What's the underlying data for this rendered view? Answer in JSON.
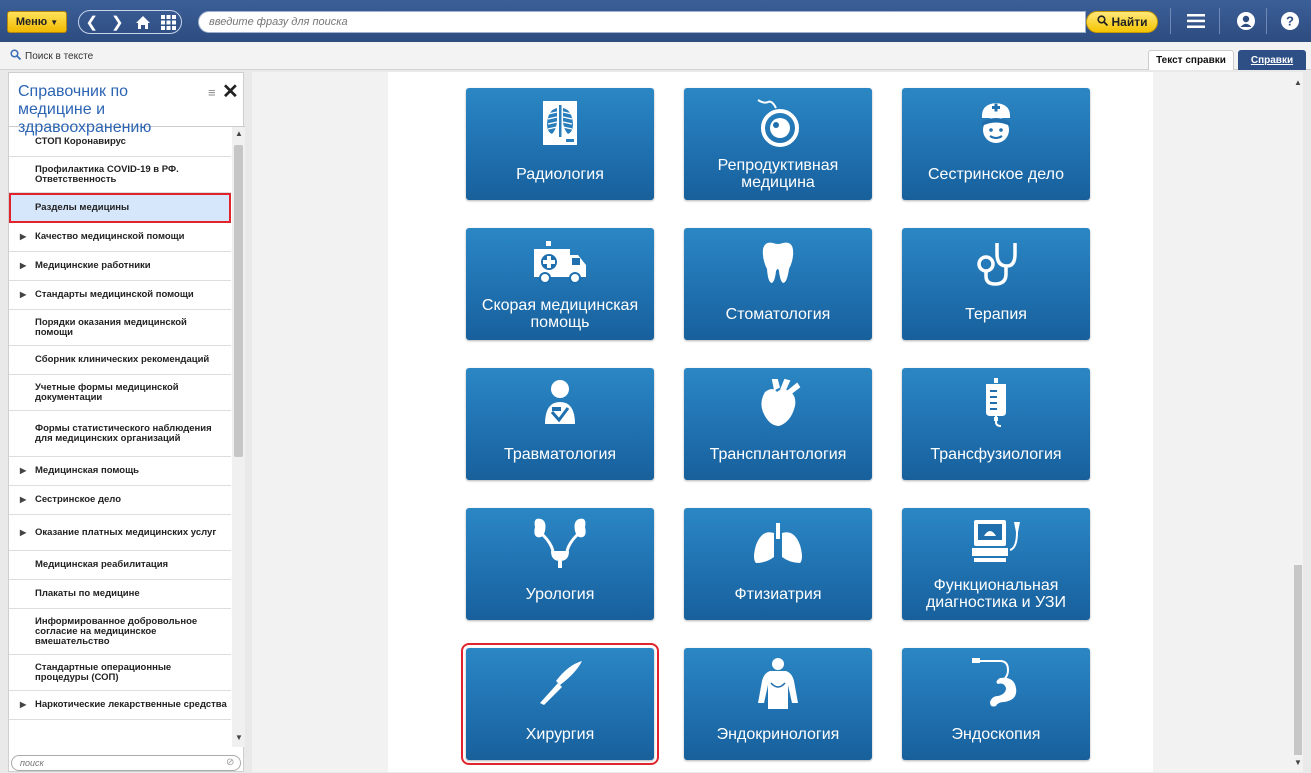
{
  "topbar": {
    "menu_label": "Меню",
    "search_placeholder": "введите фразу для поиска",
    "find_label": "Найти"
  },
  "subbar": {
    "text_search": "Поиск в тексте",
    "tab_help_text": "Текст справки",
    "tab_spravki": "Справки"
  },
  "sidebar": {
    "title": "Справочник по медицине и здравоохранению",
    "search_placeholder": "поиск",
    "items": [
      {
        "label": "СТОП Коронавирус",
        "arrow": false
      },
      {
        "label": "Профилактика COVID-19 в РФ. Ответственность",
        "arrow": false
      },
      {
        "label": "Разделы медицины",
        "arrow": false,
        "selected": true
      },
      {
        "label": "Качество медицинской помощи",
        "arrow": true
      },
      {
        "label": "Медицинские работники",
        "arrow": true
      },
      {
        "label": "Стандарты медицинской помощи",
        "arrow": true
      },
      {
        "label": "Порядки оказания медицинской помощи",
        "arrow": false
      },
      {
        "label": "Сборник клинических рекомендаций",
        "arrow": false
      },
      {
        "label": "Учетные формы медицинской документации",
        "arrow": false
      },
      {
        "label": "Формы статистического наблюдения для медицинских организаций",
        "arrow": false
      },
      {
        "label": "Медицинская помощь",
        "arrow": true
      },
      {
        "label": "Сестринское дело",
        "arrow": true
      },
      {
        "label": "Оказание платных медицинских услуг",
        "arrow": true
      },
      {
        "label": "Медицинская реабилитация",
        "arrow": false
      },
      {
        "label": "Плакаты по медицине",
        "arrow": false
      },
      {
        "label": "Информированное добровольное согласие на медицинское вмешательство",
        "arrow": false
      },
      {
        "label": "Стандартные операционные процедуры (СОП)",
        "arrow": false
      },
      {
        "label": "Наркотические лекарственные средства",
        "arrow": true
      }
    ]
  },
  "tiles": [
    {
      "label": "Радиология",
      "icon": "xray-icon"
    },
    {
      "label": "Репродуктивная медицина",
      "icon": "embryo-icon"
    },
    {
      "label": "Сестринское дело",
      "icon": "nurse-icon"
    },
    {
      "label": "Скорая медицинская помощь",
      "icon": "ambulance-icon"
    },
    {
      "label": "Стоматология",
      "icon": "tooth-icon"
    },
    {
      "label": "Терапия",
      "icon": "stethoscope-icon"
    },
    {
      "label": "Травматология",
      "icon": "patient-icon"
    },
    {
      "label": "Трансплантология",
      "icon": "heart-icon"
    },
    {
      "label": "Трансфузиология",
      "icon": "iv-bag-icon"
    },
    {
      "label": "Урология",
      "icon": "kidneys-icon"
    },
    {
      "label": "Фтизиатрия",
      "icon": "lungs-icon"
    },
    {
      "label": "Функциональная диагностика и УЗИ",
      "icon": "ultrasound-icon"
    },
    {
      "label": "Хирургия",
      "icon": "scalpel-icon",
      "highlighted": true
    },
    {
      "label": "Эндокринология",
      "icon": "body-icon"
    },
    {
      "label": "Эндоскопия",
      "icon": "endoscope-icon"
    }
  ],
  "colors": {
    "accent": "#2d4f86",
    "tile": "#1f6fae",
    "highlight": "#e1242c",
    "find": "#f5c400"
  }
}
